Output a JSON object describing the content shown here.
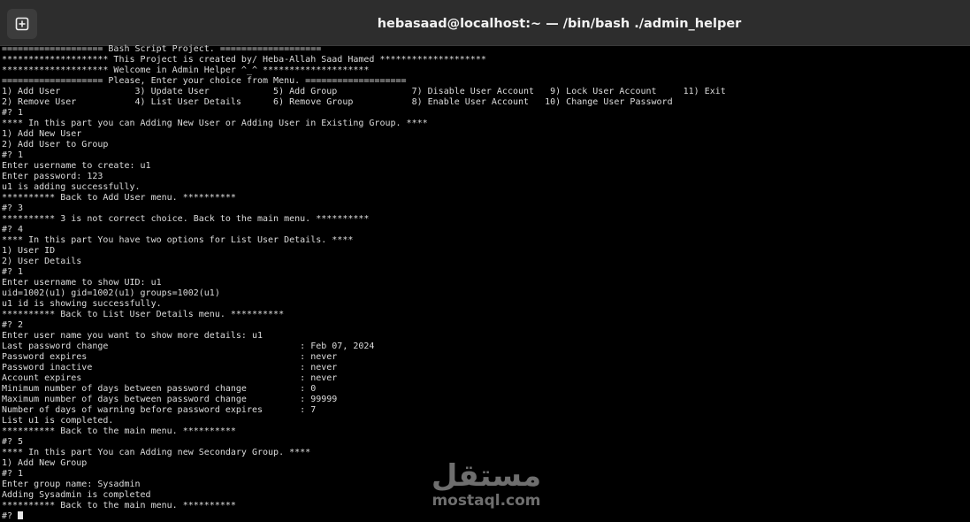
{
  "window": {
    "title": "hebasaad@localhost:~ — /bin/bash ./admin_helper"
  },
  "icons": {
    "new_tab": "new-tab-plus-icon"
  },
  "watermark": {
    "arabic": "مستقل",
    "latin": "mostaql.com"
  },
  "terminal": {
    "lines": [
      "=================== Bash Script Project. ===================",
      "******************** This Project is created by/ Heba-Allah Saad Hamed ********************",
      "******************** Welcome in Admin Helper ^_^ ********************",
      "=================== Please, Enter your choice from Menu. ===================",
      "1) Add User              3) Update User            5) Add Group              7) Disable User Account   9) Lock User Account     11) Exit",
      "2) Remove User           4) List User Details      6) Remove Group           8) Enable User Account   10) Change User Password",
      "#? 1",
      "**** In this part you can Adding New User or Adding User in Existing Group. ****",
      "1) Add New User",
      "2) Add User to Group",
      "#? 1",
      "Enter username to create: u1",
      "Enter password: 123",
      "u1 is adding successfully.",
      "********** Back to Add User menu. **********",
      "#? 3",
      "********** 3 is not correct choice. Back to the main menu. **********",
      "#? 4",
      "**** In this part You have two options for List User Details. ****",
      "1) User ID",
      "2) User Details",
      "#? 1",
      "Enter username to show UID: u1",
      "uid=1002(u1) gid=1002(u1) groups=1002(u1)",
      "u1 id is showing successfully.",
      "********** Back to List User Details menu. **********",
      "#? 2",
      "Enter user name you want to show more details: u1",
      "Last password change                                    : Feb 07, 2024",
      "Password expires                                        : never",
      "Password inactive                                       : never",
      "Account expires                                         : never",
      "Minimum number of days between password change          : 0",
      "Maximum number of days between password change          : 99999",
      "Number of days of warning before password expires       : 7",
      "List u1 is completed.",
      "********** Back to the main menu. **********",
      "#? 5",
      "**** In this part You can Adding new Secondary Group. ****",
      "1) Add New Group",
      "#? 1",
      "Enter group name: Sysadmin",
      "Adding Sysadmin is completed",
      "********** Back to the main menu. **********"
    ],
    "prompt": "#? "
  }
}
